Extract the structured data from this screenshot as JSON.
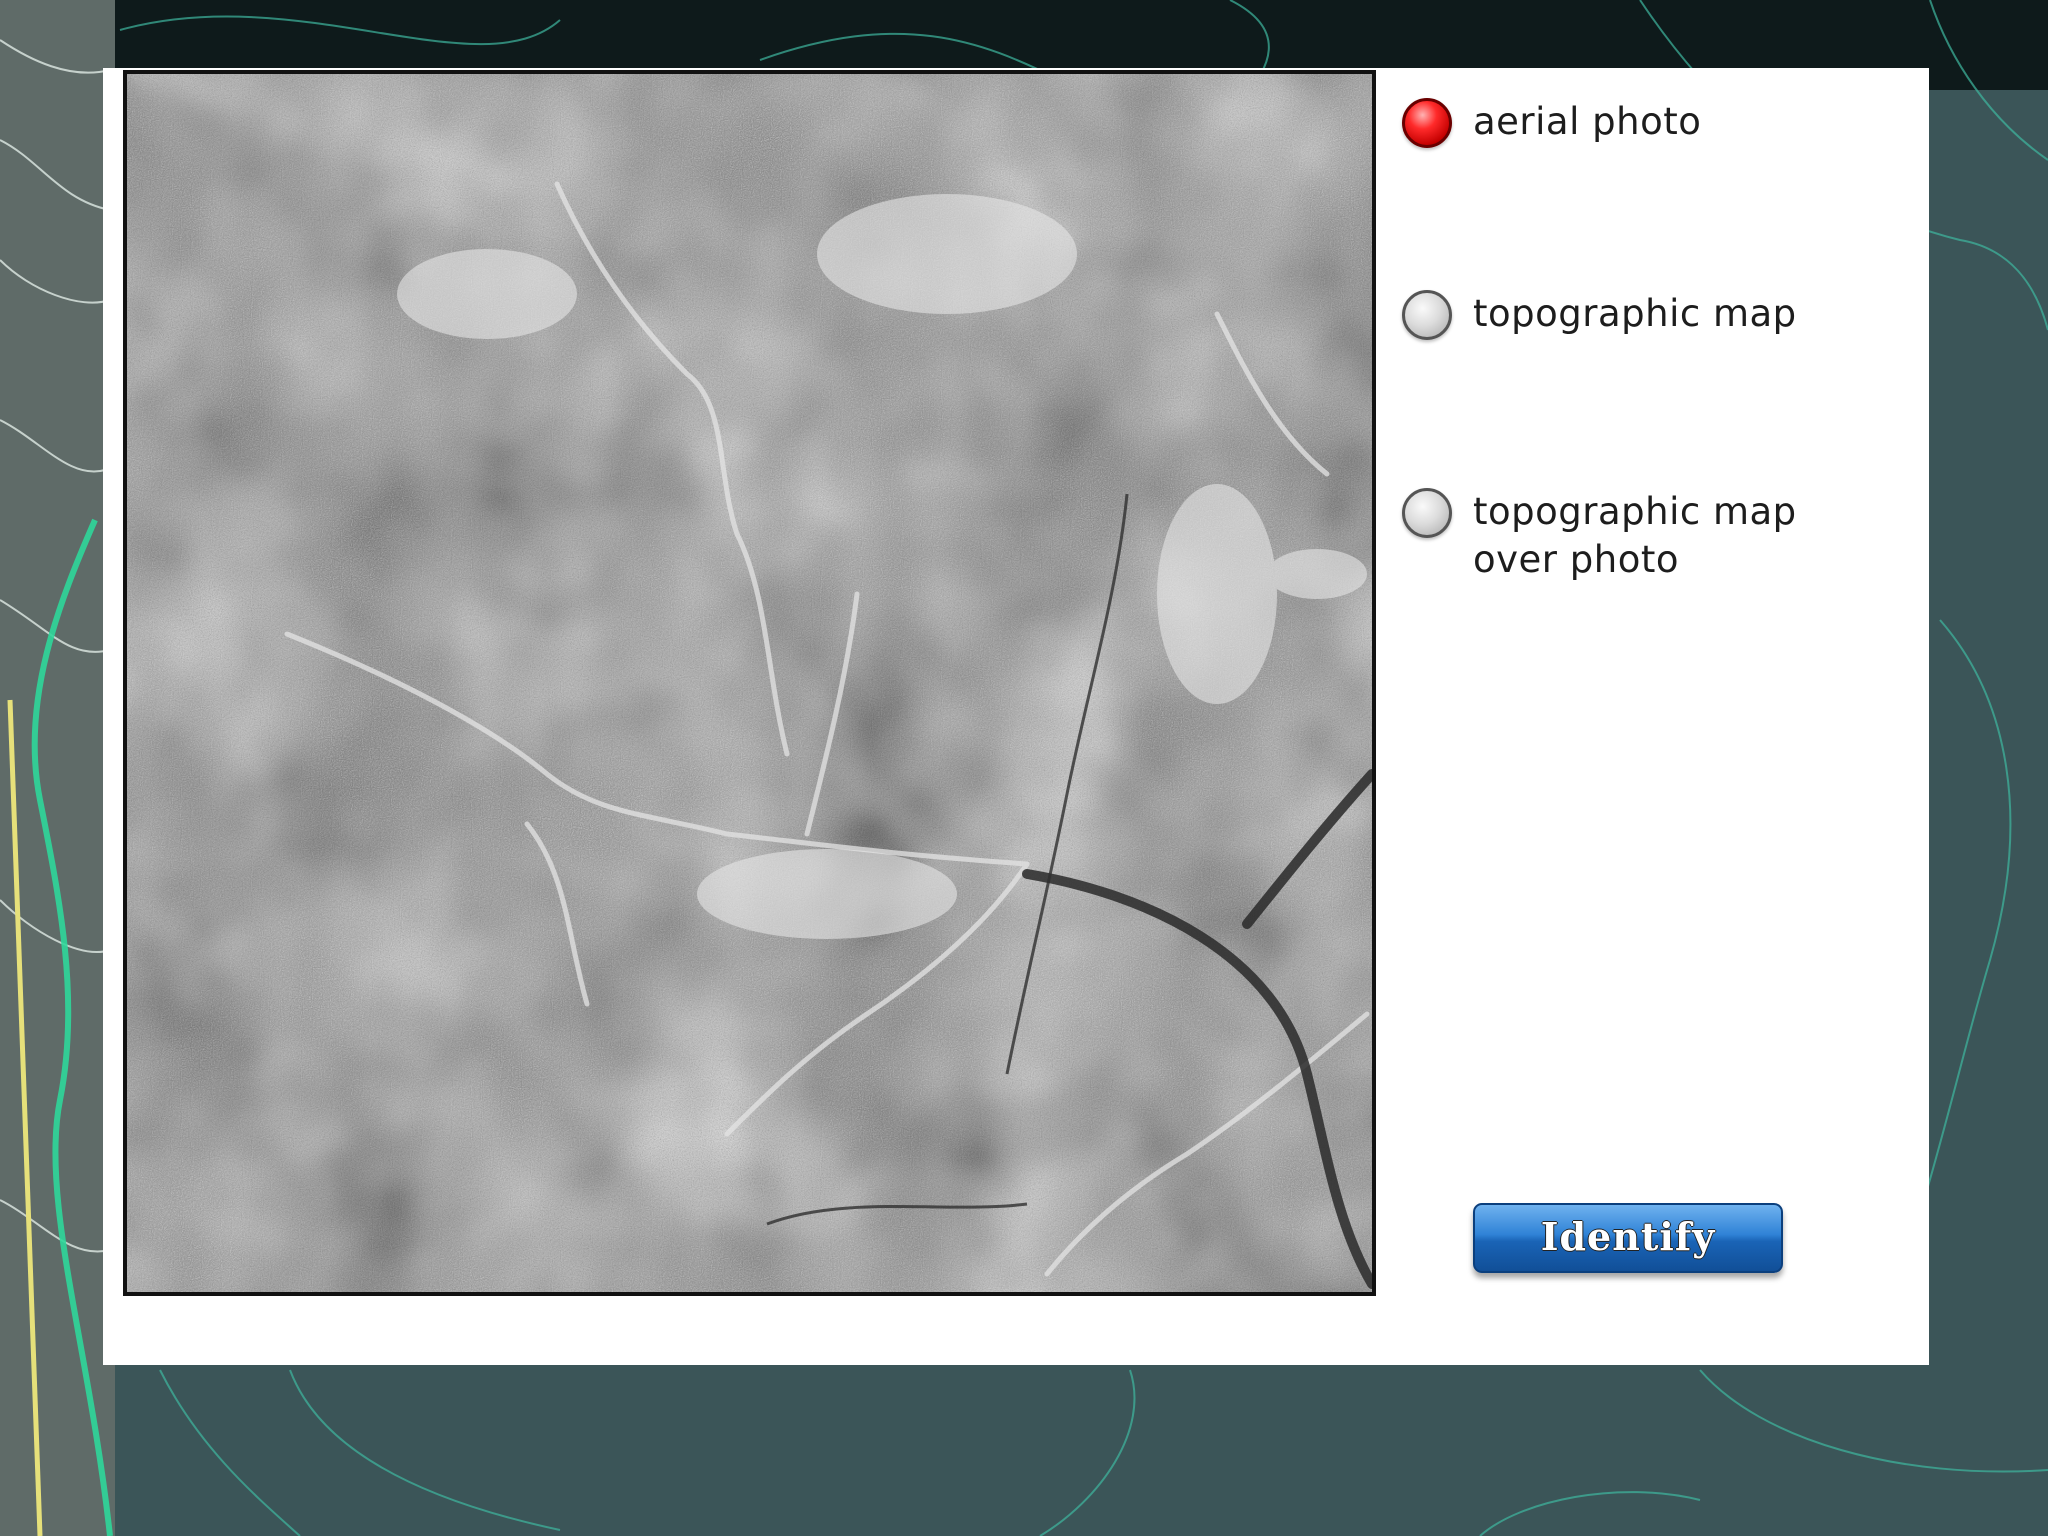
{
  "layers": {
    "options": [
      {
        "label": "aerial photo",
        "selected": true
      },
      {
        "label": "topographic map",
        "selected": false
      },
      {
        "label": "topographic map\nover photo",
        "selected": false
      }
    ]
  },
  "actions": {
    "identify_label": "Identify"
  },
  "colors": {
    "background": "#3b5558",
    "contour_line": "#3fb8a0",
    "panel": "#ffffff",
    "radio_selected": "#e00000",
    "button": "#2a78cc"
  }
}
